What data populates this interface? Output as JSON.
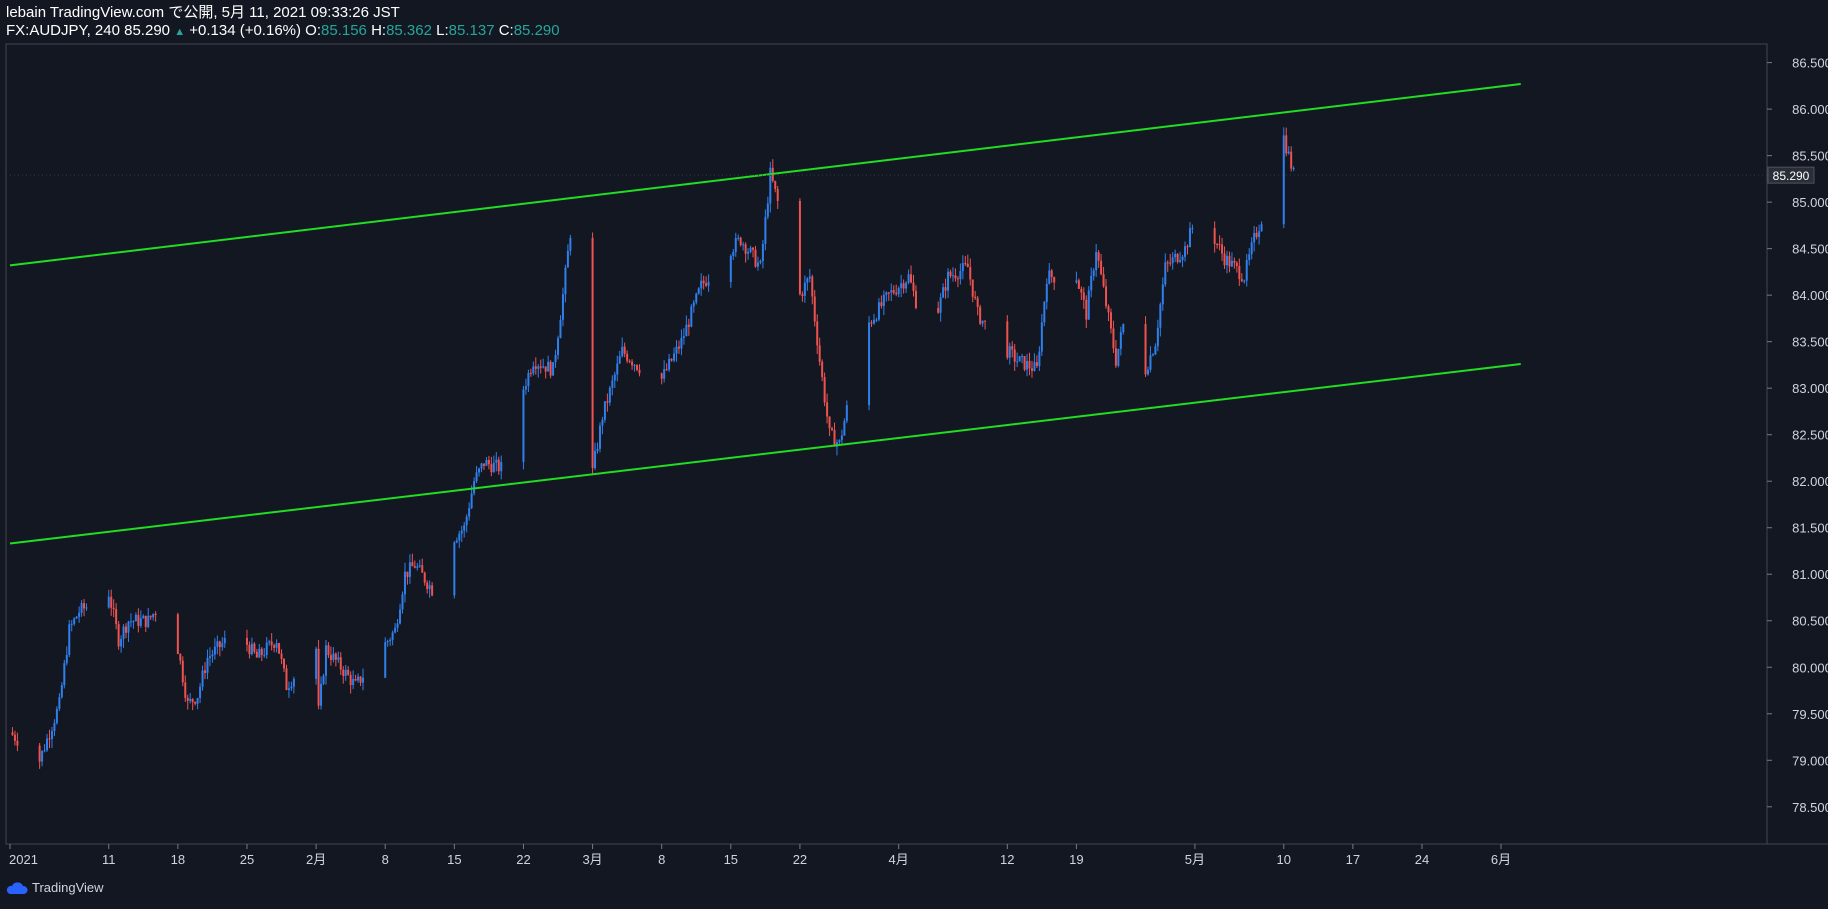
{
  "header": {
    "publish_line": "lebain TradingView.com で公開, 5月 11, 2021 09:33:26 JST",
    "symbol": "FX:AUDJPY, 240",
    "last": "85.290",
    "change": "+0.134 (+0.16%)",
    "o_label": "O:",
    "o_value": "85.156",
    "h_label": "H:",
    "h_value": "85.362",
    "l_label": "L:",
    "l_value": "85.137",
    "c_label": "C:",
    "c_value": "85.290"
  },
  "brand": {
    "name": "TradingView",
    "icon": "tradingview-cloud-icon"
  },
  "colors": {
    "background": "#131722",
    "up": "#2f80ed",
    "down": "#ef5350",
    "channel": "#22dd22",
    "text": "#d1d4dc"
  },
  "chart_data": {
    "type": "candlestick",
    "title": "",
    "instrument": "FX:AUDJPY",
    "interval": "240",
    "ylim": [
      78.1,
      86.7
    ],
    "y_ticks": [
      "86.500",
      "86.000",
      "85.500",
      "85.000",
      "84.500",
      "84.000",
      "83.500",
      "83.000",
      "82.500",
      "82.000",
      "81.500",
      "81.000",
      "80.500",
      "80.000",
      "79.500",
      "79.000",
      "78.500"
    ],
    "x_ticks": [
      "2021",
      "11",
      "18",
      "25",
      "2月",
      "8",
      "15",
      "22",
      "3月",
      "8",
      "15",
      "22",
      "4月",
      "12",
      "19",
      "5月",
      "10",
      "17",
      "24",
      "6月"
    ],
    "current_price_label": "85.290",
    "channel_lines": [
      {
        "name": "",
        "start": {
          "date": "2021-01-01",
          "y": 84.32
        },
        "end": {
          "date": "2021-06-03",
          "y": 86.27
        }
      },
      {
        "name": "",
        "start": {
          "date": "2021-01-01",
          "y": 81.33
        },
        "end": {
          "date": "2021-06-03",
          "y": 83.26
        }
      }
    ],
    "price_path": [
      {
        "date": "2021-01-01",
        "close": 79.3
      },
      {
        "date": "2021-01-04",
        "close": 79.0
      },
      {
        "date": "2021-01-06",
        "close": 79.6
      },
      {
        "date": "2021-01-07",
        "close": 80.4
      },
      {
        "date": "2021-01-08",
        "close": 80.6
      },
      {
        "date": "2021-01-11",
        "close": 80.8
      },
      {
        "date": "2021-01-12",
        "close": 80.3
      },
      {
        "date": "2021-01-13",
        "close": 80.5
      },
      {
        "date": "2021-01-15",
        "close": 80.5
      },
      {
        "date": "2021-01-17",
        "close": 80.8
      },
      {
        "date": "2021-01-18",
        "close": 80.2
      },
      {
        "date": "2021-01-19",
        "close": 79.6
      },
      {
        "date": "2021-01-20",
        "close": 79.7
      },
      {
        "date": "2021-01-21",
        "close": 80.1
      },
      {
        "date": "2021-01-24",
        "close": 80.4
      },
      {
        "date": "2021-01-26",
        "close": 80.1
      },
      {
        "date": "2021-01-28",
        "close": 80.3
      },
      {
        "date": "2021-01-29",
        "close": 79.8
      },
      {
        "date": "2021-02-01",
        "close": 80.2
      },
      {
        "date": "2021-02-01",
        "close": 79.3
      },
      {
        "date": "2021-02-02",
        "close": 80.2
      },
      {
        "date": "2021-02-05",
        "close": 79.8
      },
      {
        "date": "2021-02-07",
        "close": 80.1
      },
      {
        "date": "2021-02-09",
        "close": 80.4
      },
      {
        "date": "2021-02-10",
        "close": 81.0
      },
      {
        "date": "2021-02-11",
        "close": 81.1
      },
      {
        "date": "2021-02-13",
        "close": 80.8
      },
      {
        "date": "2021-02-14",
        "close": 81.3
      },
      {
        "date": "2021-02-16",
        "close": 81.5
      },
      {
        "date": "2021-02-17",
        "close": 82.0
      },
      {
        "date": "2021-02-18",
        "close": 82.2
      },
      {
        "date": "2021-02-21",
        "close": 82.1
      },
      {
        "date": "2021-02-22",
        "close": 83.0
      },
      {
        "date": "2021-02-23",
        "close": 83.3
      },
      {
        "date": "2021-02-25",
        "close": 83.2
      },
      {
        "date": "2021-02-26",
        "close": 84.0
      },
      {
        "date": "2021-02-27",
        "close": 84.9
      },
      {
        "date": "2021-02-28",
        "close": 83.2
      },
      {
        "date": "2021-03-01",
        "close": 82.1
      },
      {
        "date": "2021-03-02",
        "close": 82.7
      },
      {
        "date": "2021-03-04",
        "close": 83.4
      },
      {
        "date": "2021-03-06",
        "close": 83.2
      },
      {
        "date": "2021-03-08",
        "close": 83.1
      },
      {
        "date": "2021-03-10",
        "close": 83.5
      },
      {
        "date": "2021-03-12",
        "close": 84.1
      },
      {
        "date": "2021-03-15",
        "close": 84.5
      },
      {
        "date": "2021-03-16",
        "close": 84.6
      },
      {
        "date": "2021-03-18",
        "close": 84.3
      },
      {
        "date": "2021-03-19",
        "close": 85.3
      },
      {
        "date": "2021-03-20",
        "close": 84.9
      },
      {
        "date": "2021-03-21",
        "close": 84.4
      },
      {
        "date": "2021-03-22",
        "close": 84.0
      },
      {
        "date": "2021-03-23",
        "close": 84.2
      },
      {
        "date": "2021-03-24",
        "close": 83.3
      },
      {
        "date": "2021-03-25",
        "close": 82.5
      },
      {
        "date": "2021-03-26",
        "close": 82.4
      },
      {
        "date": "2021-03-27",
        "close": 82.9
      },
      {
        "date": "2021-03-29",
        "close": 83.7
      },
      {
        "date": "2021-03-31",
        "close": 84.0
      },
      {
        "date": "2021-04-02",
        "close": 84.2
      },
      {
        "date": "2021-04-04",
        "close": 83.5
      },
      {
        "date": "2021-04-06",
        "close": 84.2
      },
      {
        "date": "2021-04-08",
        "close": 84.3
      },
      {
        "date": "2021-04-09",
        "close": 83.8
      },
      {
        "date": "2021-04-11",
        "close": 83.5
      },
      {
        "date": "2021-04-13",
        "close": 83.3
      },
      {
        "date": "2021-04-15",
        "close": 83.2
      },
      {
        "date": "2021-04-16",
        "close": 84.2
      },
      {
        "date": "2021-04-19",
        "close": 84.2
      },
      {
        "date": "2021-04-20",
        "close": 83.8
      },
      {
        "date": "2021-04-21",
        "close": 84.5
      },
      {
        "date": "2021-04-22",
        "close": 83.9
      },
      {
        "date": "2021-04-23",
        "close": 83.3
      },
      {
        "date": "2021-04-24",
        "close": 83.8
      },
      {
        "date": "2021-04-26",
        "close": 83.2
      },
      {
        "date": "2021-04-27",
        "close": 83.5
      },
      {
        "date": "2021-04-28",
        "close": 84.3
      },
      {
        "date": "2021-04-30",
        "close": 84.5
      },
      {
        "date": "2021-05-01",
        "close": 84.8
      },
      {
        "date": "2021-05-03",
        "close": 84.6
      },
      {
        "date": "2021-05-04",
        "close": 84.4
      },
      {
        "date": "2021-05-06",
        "close": 84.2
      },
      {
        "date": "2021-05-07",
        "close": 84.6
      },
      {
        "date": "2021-05-08",
        "close": 84.9
      },
      {
        "date": "2021-05-09",
        "close": 85.2
      },
      {
        "date": "2021-05-10",
        "close": 85.7
      },
      {
        "date": "2021-05-11",
        "close": 85.3
      }
    ]
  }
}
